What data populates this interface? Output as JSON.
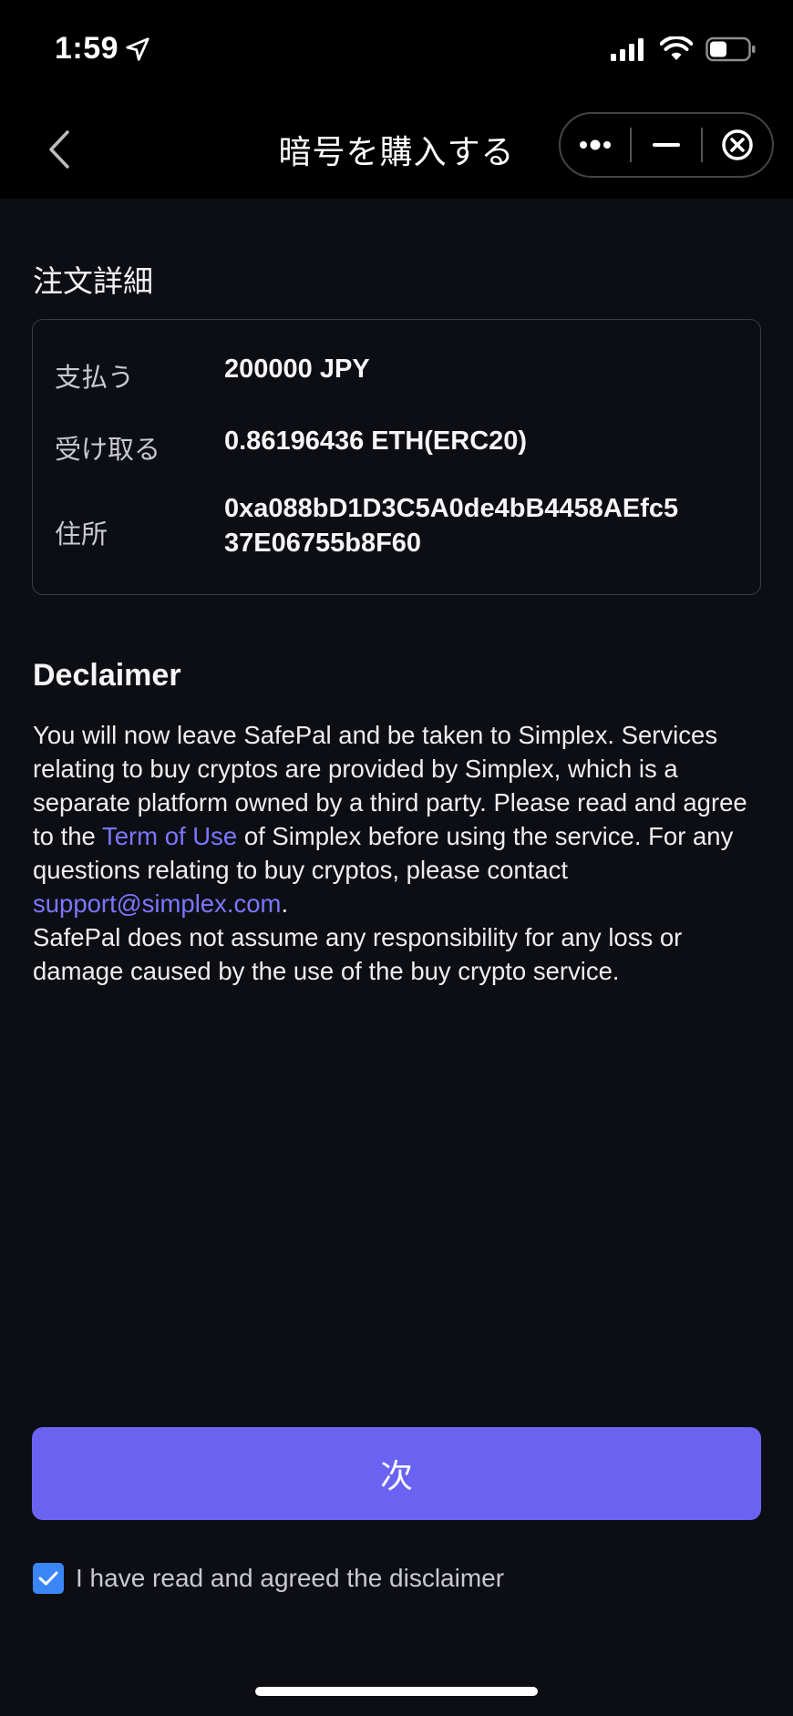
{
  "status_bar": {
    "time": "1:59"
  },
  "nav": {
    "title": "暗号を購入する"
  },
  "order": {
    "section_title": "注文詳細",
    "rows": [
      {
        "label": "支払う",
        "value": "200000 JPY"
      },
      {
        "label": "受け取る",
        "value": "0.86196436 ETH(ERC20)"
      },
      {
        "label": "住所",
        "value_line1": "0xa088bD1D3C5A0de4bB4458AEfc5",
        "value_line2": "37E06755b8F60"
      }
    ]
  },
  "disclaimer": {
    "title": "Declaimer",
    "text_1": "You will now leave SafePal and be taken to Simplex. Services relating to buy cryptos are provided by Simplex, which is a separate platform owned by a third party. Please read and agree to the ",
    "term_link": "Term of Use",
    "text_2": " of Simplex before using the service. For any questions relating to buy cryptos, please contact ",
    "email_link": "support@simplex.com",
    "text_3": ".",
    "text_4": "SafePal does not assume any responsibility for any loss or damage caused by the use of the buy crypto service."
  },
  "actions": {
    "next_label": "次",
    "agree_label": "I have read and agreed the disclaimer",
    "agree_checked": true
  },
  "colors": {
    "accent": "#6a63f2",
    "link": "#7b76ff",
    "checkbox": "#3b86f7",
    "background": "#0d0e14"
  }
}
